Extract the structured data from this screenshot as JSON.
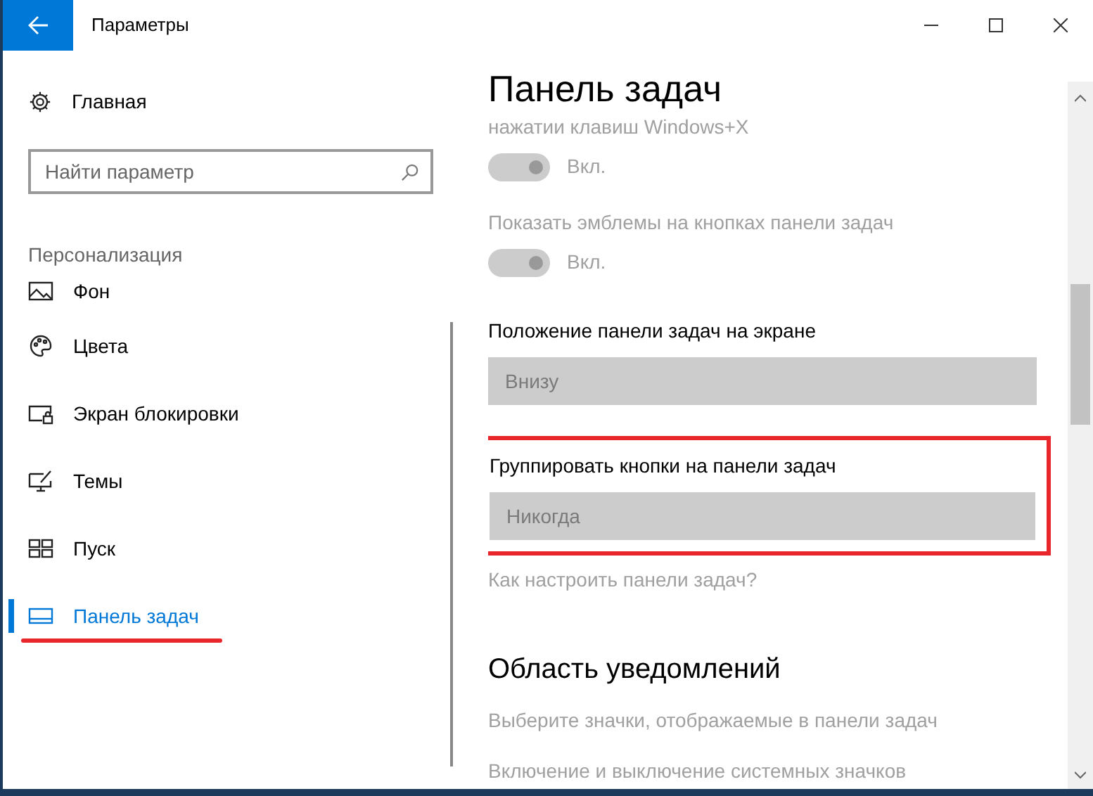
{
  "window": {
    "title": "Параметры"
  },
  "sidebar": {
    "home": "Главная",
    "search": {
      "placeholder": "Найти параметр"
    },
    "section": "Персонализация",
    "items": [
      {
        "label": "Фон",
        "selected": false,
        "underlined": false
      },
      {
        "label": "Цвета",
        "selected": false,
        "underlined": false
      },
      {
        "label": "Экран блокировки",
        "selected": false,
        "underlined": false
      },
      {
        "label": "Темы",
        "selected": false,
        "underlined": false
      },
      {
        "label": "Пуск",
        "selected": false,
        "underlined": false
      },
      {
        "label": "Панель задач",
        "selected": true,
        "underlined": true
      }
    ]
  },
  "content": {
    "title": "Панель задач",
    "settings": [
      {
        "kind": "toggle",
        "label": "нажатии клавиш Windows+X",
        "value": "Вкл.",
        "on": true,
        "disabled": true,
        "highlighted": false
      },
      {
        "kind": "toggle",
        "label": "Показать эмблемы на кнопках панели задач",
        "value": "Вкл.",
        "on": true,
        "disabled": true,
        "highlighted": false
      },
      {
        "kind": "dropdown",
        "label": "Положение панели задач на экране",
        "value": "Внизу",
        "disabled": true,
        "highlighted": false
      },
      {
        "kind": "dropdown",
        "label": "Группировать кнопки на панели задач",
        "value": "Никогда",
        "disabled": true,
        "highlighted": true
      },
      {
        "kind": "link",
        "label": "Как настроить панели задач?",
        "disabled": true,
        "highlighted": false
      },
      {
        "kind": "heading",
        "label": "Область уведомлений",
        "highlighted": false
      },
      {
        "kind": "link",
        "label": "Выберите значки, отображаемые в панели задач",
        "disabled": true,
        "highlighted": false
      },
      {
        "kind": "link",
        "label": "Включение и выключение системных значков",
        "disabled": true,
        "highlighted": false
      }
    ]
  }
}
